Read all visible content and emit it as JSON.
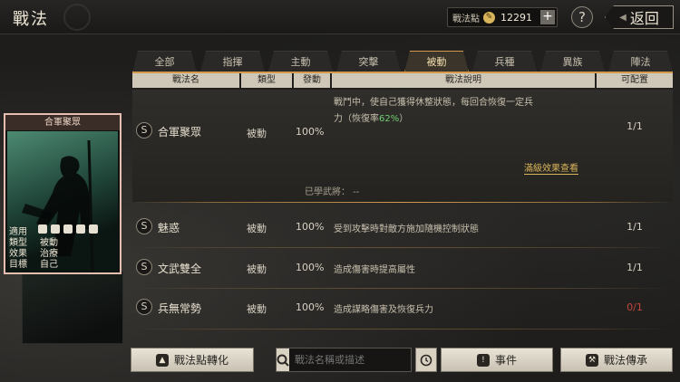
{
  "header": {
    "title": "戰法",
    "points_label": "戰法點",
    "points_value": "12291",
    "plus_label": "+",
    "help_label": "?",
    "back_label": "返回"
  },
  "tabs": [
    {
      "label": "全部",
      "active": false
    },
    {
      "label": "指揮",
      "active": false
    },
    {
      "label": "主動",
      "active": false
    },
    {
      "label": "突擊",
      "active": false
    },
    {
      "label": "被動",
      "active": true
    },
    {
      "label": "兵種",
      "active": false
    },
    {
      "label": "異族",
      "active": false
    },
    {
      "label": "陣法",
      "active": false
    }
  ],
  "columns": {
    "name": "戰法名",
    "type": "類型",
    "rate": "發動",
    "desc": "戰法說明",
    "count": "可配置"
  },
  "expanded_row": {
    "badge": "S",
    "name": "合軍聚眾",
    "type": "被動",
    "rate": "100%",
    "desc_line1": "戰鬥中，使自己獲得休整狀態，每回合恢復一定兵",
    "desc_line2_prefix": "力（恢復率",
    "desc_line2_rate": "62%",
    "desc_line2_suffix": "）",
    "count": "1/1",
    "max_effect_link": "滿級效果查看",
    "learned_label": "已學武將：  --"
  },
  "rows": [
    {
      "badge": "S",
      "name": "魅惑",
      "type": "被動",
      "rate": "100%",
      "desc": "受到攻擊時對敵方施加隨機控制狀態",
      "count": "1/1",
      "count_color": "#d9d2c3"
    },
    {
      "badge": "S",
      "name": "文武雙全",
      "type": "被動",
      "rate": "100%",
      "desc": "造成傷害時提高屬性",
      "count": "1/1",
      "count_color": "#d9d2c3"
    },
    {
      "badge": "S",
      "name": "兵無常勢",
      "type": "被動",
      "rate": "100%",
      "desc": "造成謀略傷害及恢復兵力",
      "count": "0/1",
      "count_color": "#c2463c"
    }
  ],
  "card": {
    "title": "合軍聚眾",
    "info": [
      {
        "key": "適用",
        "value": ""
      },
      {
        "key": "類型",
        "value": "被動"
      },
      {
        "key": "效果",
        "value": "治療"
      },
      {
        "key": "目標",
        "value": "自己"
      }
    ],
    "icons": [
      "cavalry-icon",
      "shield-icon",
      "archer-icon",
      "spear-icon",
      "siege-icon"
    ]
  },
  "bottom": {
    "convert_label": "戰法點轉化",
    "search_placeholder": "戰法名稱或描述",
    "event_label": "事件",
    "inherit_label": "戰法傳承"
  },
  "colors": {
    "accent": "#d39a4d",
    "rate_green": "#6fcf73",
    "warning_red": "#c2463c"
  }
}
